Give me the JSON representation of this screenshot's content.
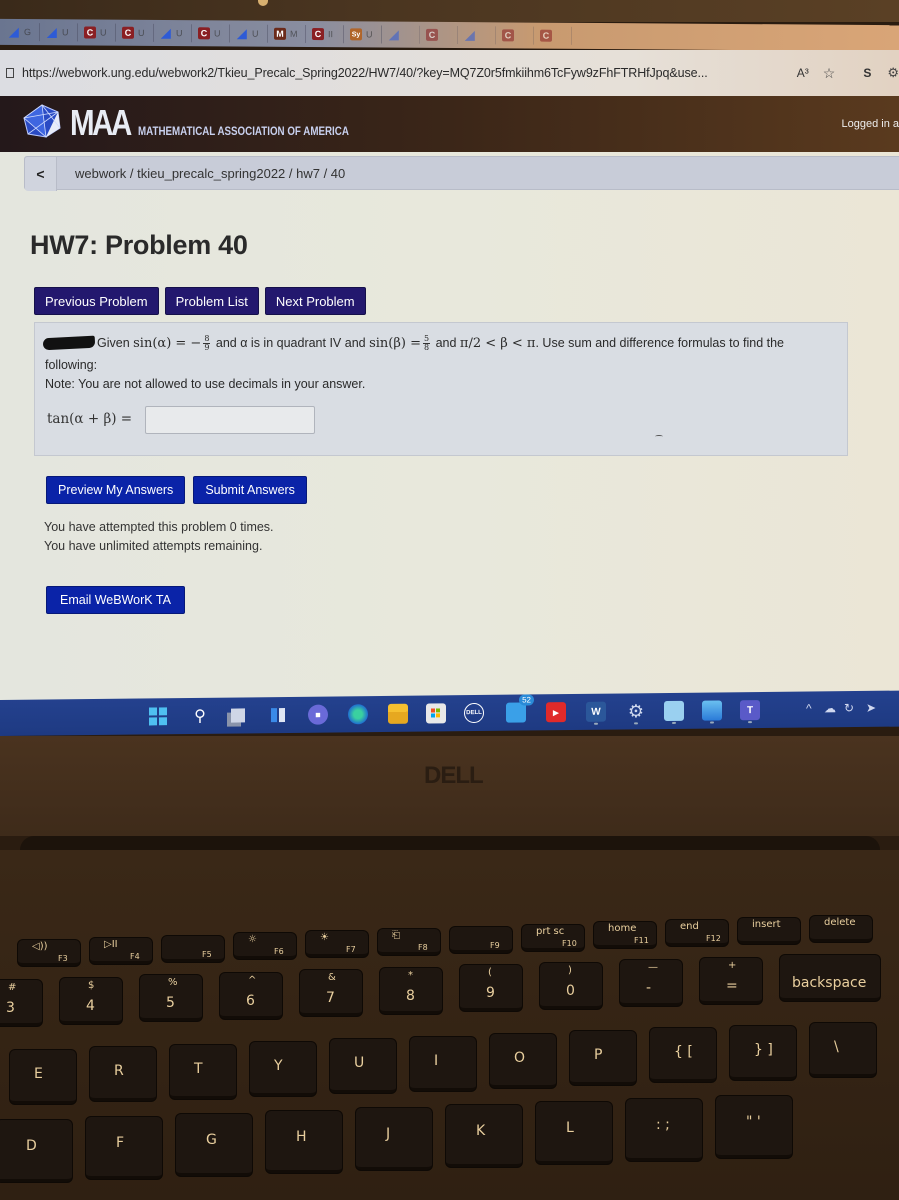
{
  "browser": {
    "tabs": [
      {
        "favicon": "bing-icon",
        "label": "G"
      },
      {
        "favicon": "bing-icon",
        "label": "U"
      },
      {
        "favicon": "C",
        "label": "U"
      },
      {
        "favicon": "C",
        "label": "U"
      },
      {
        "favicon": "bing-icon",
        "label": "U"
      },
      {
        "favicon": "C",
        "label": "U"
      },
      {
        "favicon": "bing-icon",
        "label": "U"
      },
      {
        "favicon": "M",
        "label": "M"
      },
      {
        "favicon": "C",
        "label": "II"
      },
      {
        "favicon": "Sy",
        "label": "U"
      },
      {
        "favicon": "bing-icon",
        "label": ""
      },
      {
        "favicon": "C",
        "label": ""
      },
      {
        "favicon": "bing-icon",
        "label": ""
      },
      {
        "favicon": "C",
        "label": ""
      },
      {
        "favicon": "C",
        "label": ""
      }
    ],
    "url": "https://webwork.ung.edu/webwork2/Tkieu_Precalc_Spring2022/HW7/40/?key=MQ7Z0r5fmkiihm6TcFyw9zFhFTRHfJpq&use...",
    "read_aloud_label": "A³",
    "profile_label": "S"
  },
  "header": {
    "logo_text": "MAA",
    "org_name": "MATHEMATICAL ASSOCIATION OF AMERICA",
    "logged_in": "Logged in a"
  },
  "breadcrumb": {
    "back_label": "<",
    "path": "webwork / tkieu_precalc_spring2022 / hw7 / 40"
  },
  "problem": {
    "title": "HW7: Problem 40",
    "nav": {
      "previous": "Previous Problem",
      "list": "Problem List",
      "next": "Next Problem"
    },
    "text_given": "Given",
    "sin_alpha": "sin(α) = −",
    "frac1_num": "8",
    "frac1_den": "9",
    "text_mid": "and α is in quadrant IV and",
    "sin_beta": "sin(β) =",
    "frac2_num": "5",
    "frac2_den": "8",
    "text_and": "and",
    "beta_range": "π/2 < β < π",
    "text_end": ". Use sum and difference formulas to find the",
    "following": "following:",
    "note": "Note: You are not allowed to use decimals in your answer.",
    "answer_label": "tan(α + β) =",
    "answer_value": ""
  },
  "actions": {
    "preview": "Preview My Answers",
    "submit": "Submit Answers",
    "attempts_line1": "You have attempted this problem 0 times.",
    "attempts_line2": "You have unlimited attempts remaining.",
    "email_ta": "Email WeBWorK TA"
  },
  "taskbar": {
    "apps": [
      "start-icon",
      "search-icon",
      "task-view-icon",
      "widgets-icon",
      "teams-chat-icon",
      "edge-icon",
      "file-explorer-icon",
      "store-icon",
      "dell-icon",
      "mail-icon",
      "youtube-icon",
      "word-icon",
      "settings-icon",
      "whiteboard-icon",
      "photos-icon",
      "teams-icon"
    ],
    "mail_badge": "52",
    "tray": [
      "^",
      "☁",
      "↻",
      "➤"
    ]
  },
  "laptop": {
    "brand": "DELL"
  },
  "keyboard": {
    "fn_row": [
      {
        "icon": "◁))",
        "fn": "F3"
      },
      {
        "icon": "▷II",
        "fn": "F4"
      },
      {
        "icon": "",
        "fn": "F5"
      },
      {
        "icon": "☼",
        "fn": "F6"
      },
      {
        "icon": "☀",
        "fn": "F7"
      },
      {
        "icon": "⎗",
        "fn": "F8"
      },
      {
        "icon": "",
        "fn": "F9"
      },
      {
        "icon": "prt sc",
        "fn": "F10"
      },
      {
        "icon": "home",
        "fn": "F11"
      },
      {
        "icon": "end",
        "fn": "F12"
      },
      {
        "icon": "insert",
        "fn": ""
      },
      {
        "icon": "delete",
        "fn": ""
      }
    ],
    "num_row": [
      {
        "top": "#",
        "main": "3"
      },
      {
        "top": "$",
        "main": "4"
      },
      {
        "top": "%",
        "main": "5"
      },
      {
        "top": "^",
        "main": "6"
      },
      {
        "top": "&",
        "main": "7"
      },
      {
        "top": "*",
        "main": "8"
      },
      {
        "top": "(",
        "main": "9"
      },
      {
        "top": ")",
        "main": "0"
      },
      {
        "top": "—",
        "main": "-"
      },
      {
        "top": "+",
        "main": "="
      },
      {
        "top": "",
        "main": "backspace"
      }
    ],
    "top_row": [
      "E",
      "R",
      "T",
      "Y",
      "U",
      "I",
      "O",
      "P",
      "{ [",
      "} ]",
      "\\"
    ],
    "home_row": [
      "D",
      "F",
      "G",
      "H",
      "J",
      "K",
      "L",
      ": ;",
      "\" '"
    ]
  }
}
